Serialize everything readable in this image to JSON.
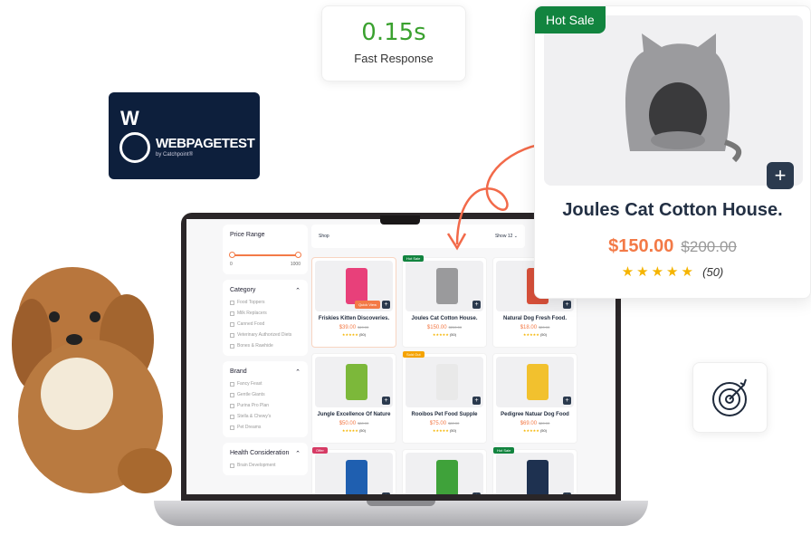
{
  "speed": {
    "value": "0.15s",
    "label": "Fast Response"
  },
  "webpagetest": {
    "letter": "W",
    "title": "WEBPAGETEST",
    "subtitle": "by Catchpoint®"
  },
  "shop": {
    "price_range": {
      "title": "Price Range",
      "min": "0",
      "max": "1000"
    },
    "category": {
      "title": "Category",
      "items": [
        "Food Toppers",
        "Milk Replacers",
        "Canned Food",
        "Veterinary Authorized Diets",
        "Bones & Rawhide"
      ]
    },
    "brand": {
      "title": "Brand",
      "items": [
        "Fancy Feast",
        "Gentle Giants",
        "Purina Pro Plan",
        "Stella & Chewy's",
        "Pet Dreams"
      ]
    },
    "health": {
      "title": "Health Consideration",
      "items": [
        "Brain Development"
      ]
    },
    "topbar": {
      "title": "Shop",
      "show_label": "Show",
      "show_value": "12"
    },
    "quick_view": "Quick View",
    "products": [
      {
        "name": "Friskies Kitten Discoveries.",
        "price": "$39.00",
        "old": "$49.00",
        "rating": "(50)",
        "badge": "",
        "color": "#e8407a"
      },
      {
        "name": "Joules Cat Cotton House.",
        "price": "$150.00",
        "old": "$200.00",
        "rating": "(50)",
        "badge": "Hot Sale",
        "badge_color": "#12843f",
        "color": "#9a9a9c"
      },
      {
        "name": "Natural Dog Fresh Food.",
        "price": "$18.00",
        "old": "$20.00",
        "rating": "(50)",
        "badge": "",
        "color": "#d8503a"
      },
      {
        "name": "Jungle Excellence Of Nature",
        "price": "$50.00",
        "old": "$80.00",
        "rating": "(50)",
        "badge": "",
        "color": "#7cb83a"
      },
      {
        "name": "Rooibos Pet Food Supple",
        "price": "$75.00",
        "old": "$80.00",
        "rating": "(50)",
        "badge": "Sold Out",
        "badge_color": "#f5a300",
        "color": "#e9e9e9"
      },
      {
        "name": "Pedigree Natuar Dog Food",
        "price": "$69.00",
        "old": "$89.00",
        "rating": "(50)",
        "badge": "",
        "color": "#f2c12e"
      },
      {
        "name": "",
        "price": "",
        "old": "",
        "rating": "",
        "badge": "Offer",
        "badge_color": "#d63a64",
        "color": "#1f5fb0"
      },
      {
        "name": "",
        "price": "",
        "old": "",
        "rating": "",
        "badge": "",
        "color": "#3fa23a"
      },
      {
        "name": "",
        "price": "",
        "old": "",
        "rating": "",
        "badge": "Hot Sale",
        "badge_color": "#12843f",
        "color": "#1e3150"
      }
    ]
  },
  "popup": {
    "badge": "Hot Sale",
    "name": "Joules Cat Cotton House.",
    "price": "$150.00",
    "old_price": "$200.00",
    "rating": "(50)",
    "stars": "★★★★★"
  }
}
